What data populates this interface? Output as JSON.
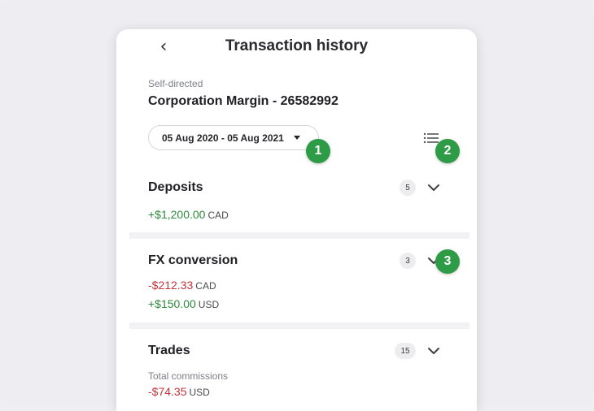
{
  "header": {
    "back_icon": "chevron-left-icon",
    "title": "Transaction history"
  },
  "account": {
    "type": "Self-directed",
    "name": "Corporation Margin - 26582992"
  },
  "filters": {
    "date_range": "05 Aug 2020 - 05 Aug 2021",
    "dropdown_icon": "caret-down-icon",
    "list_icon": "list-filter-icon"
  },
  "markers": [
    "1",
    "2",
    "3"
  ],
  "sections": {
    "deposits": {
      "title": "Deposits",
      "count": "5",
      "amounts": [
        {
          "value": "+$1,200.00",
          "currency": "CAD"
        }
      ]
    },
    "fx": {
      "title": "FX conversion",
      "count": "3",
      "amounts": [
        {
          "value": "-$212.33",
          "currency": "CAD"
        },
        {
          "value": "+$150.00",
          "currency": "USD"
        }
      ]
    },
    "trades": {
      "title": "Trades",
      "count": "15",
      "note": "Total commissions",
      "amounts": [
        {
          "value": "-$74.35",
          "currency": "USD"
        }
      ]
    }
  },
  "colors": {
    "positive": "#2d8a3a",
    "negative": "#c8323a",
    "marker": "#2e9c47",
    "background": "#eeeef2"
  }
}
